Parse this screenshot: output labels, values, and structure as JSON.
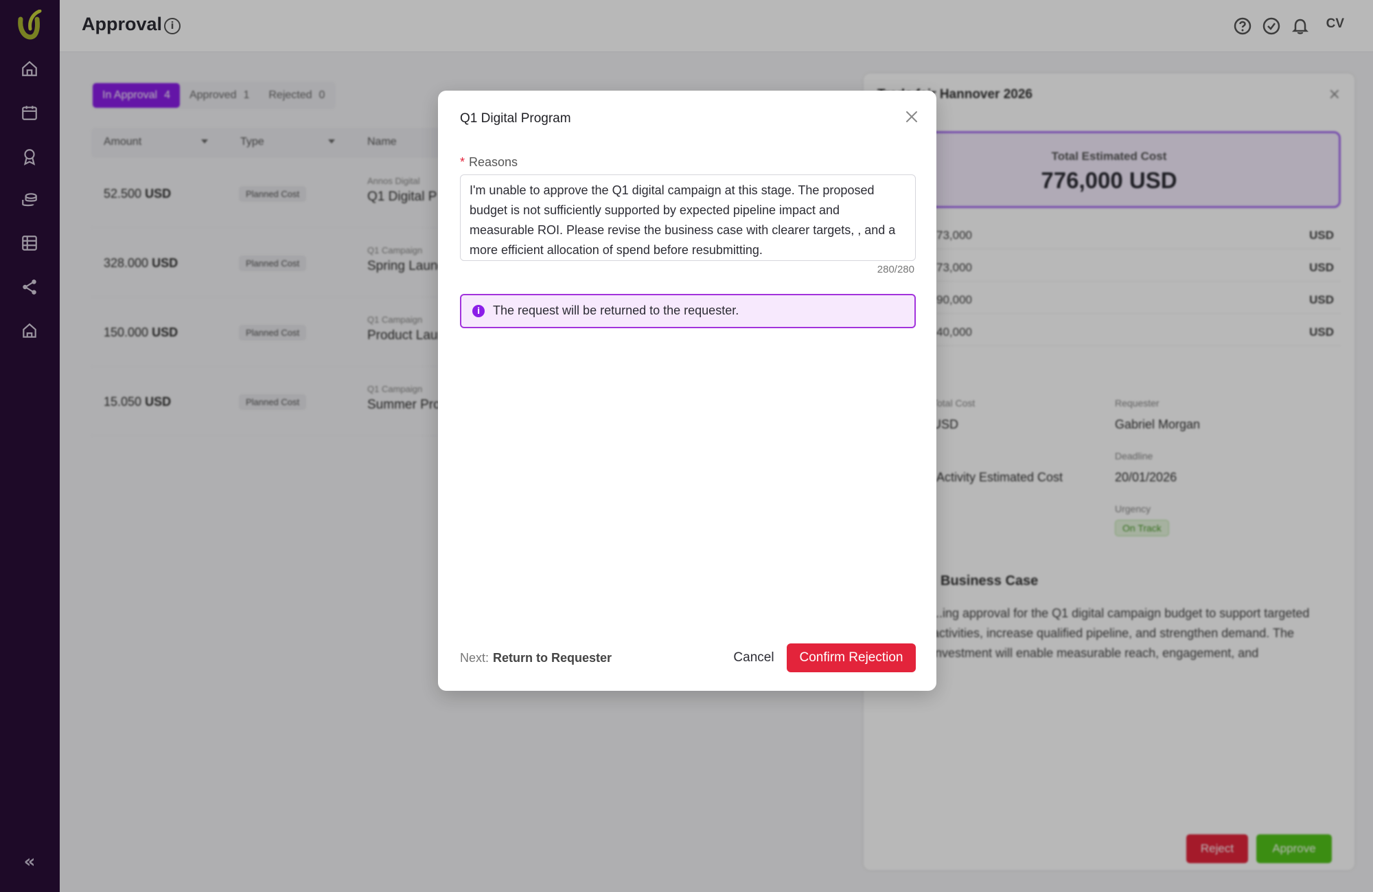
{
  "header": {
    "title": "Approval",
    "avatar_initials": "CV"
  },
  "tabs": [
    {
      "label": "In Approval",
      "count": "4"
    },
    {
      "label": "Approved",
      "count": "1"
    },
    {
      "label": "Rejected",
      "count": "0"
    }
  ],
  "table": {
    "columns": [
      "Amount",
      "Type",
      "Name"
    ],
    "rows": [
      {
        "amount": "52.500",
        "currency": "USD",
        "type": "Planned Cost",
        "name_sub": "Annos Digital",
        "name": "Q1 Digital P"
      },
      {
        "amount": "328.000",
        "currency": "USD",
        "type": "Planned Cost",
        "name_sub": "Q1 Campaign",
        "name": "Spring Launc"
      },
      {
        "amount": "150.000",
        "currency": "USD",
        "type": "Planned Cost",
        "name_sub": "Q1 Campaign",
        "name": "Product Laun"
      },
      {
        "amount": "15.050",
        "currency": "USD",
        "type": "Planned Cost",
        "name_sub": "Q1 Campaign",
        "name": "Summer Pro"
      }
    ]
  },
  "panel": {
    "title": "Trade fair Hannover 2026",
    "total_label": "Total Estimated Cost",
    "total_value": "776,000 USD",
    "cost_rows": [
      {
        "value": "73,000",
        "currency": "USD"
      },
      {
        "value": "73,000",
        "currency": "USD"
      },
      {
        "value": "90,000",
        "currency": "USD"
      },
      {
        "value": "40,000",
        "currency": "USD"
      }
    ],
    "details": {
      "total_cost_label": "Total Cost",
      "total_cost_value": "USD",
      "requester_label": "Requester",
      "requester_value": "Gabriel Morgan",
      "type_value": "Activity Estimated Cost",
      "deadline_label": "Deadline",
      "deadline_value": "20/01/2026",
      "urgency_label": "Urgency",
      "urgency_value": "On Track"
    },
    "business_case_title": "Business Case",
    "business_case_text": "...ing approval for the Q1 digital campaign budget to support targeted activities, increase qualified pipeline, and strengthen demand. The investment will enable measurable reach, engagement, and",
    "reject_label": "Reject",
    "approve_label": "Approve"
  },
  "modal": {
    "title": "Q1 Digital Program",
    "reasons_label": "Reasons",
    "reasons_text": "I'm unable to approve the Q1 digital campaign at this stage. The proposed budget is not sufficiently supported by expected pipeline impact and measurable ROI. Please revise the business case with clearer targets, , and a more efficient allocation of spend before resubmitting.",
    "char_counter": "280/280",
    "notice_text": "The request will be returned to the requester.",
    "next_label": "Next:",
    "next_value": "Return to Requester",
    "cancel_label": "Cancel",
    "confirm_label": "Confirm Rejection"
  },
  "colors": {
    "sidebar_bg": "#2a0f38",
    "accent_purple": "#8b1ee8",
    "danger_red": "#e3243b",
    "success_green": "#52c41a"
  }
}
